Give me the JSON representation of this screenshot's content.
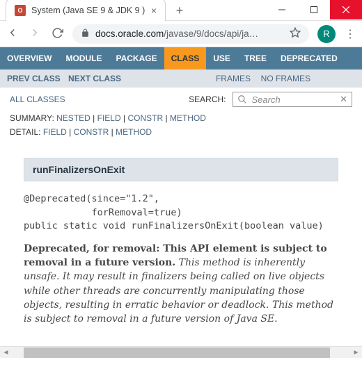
{
  "window": {
    "tab_title": "System (Java SE 9 & JDK 9 )",
    "favicon_letter": "O",
    "avatar_letter": "R"
  },
  "address": {
    "lock": "🔒",
    "domain": "docs.oracle.com",
    "path": "/javase/9/docs/api/ja…"
  },
  "nav": {
    "items": [
      "OVERVIEW",
      "MODULE",
      "PACKAGE",
      "CLASS",
      "USE",
      "TREE",
      "DEPRECATED"
    ],
    "active_index": 3,
    "sub": {
      "prev": "PREV CLASS",
      "next": "NEXT CLASS",
      "frames": "FRAMES",
      "noframes": "NO FRAMES"
    },
    "allclasses": "ALL CLASSES",
    "search_label": "SEARCH:",
    "search_placeholder": "Search",
    "summary_label": "SUMMARY:",
    "summary_links": [
      "NESTED",
      "FIELD",
      "CONSTR",
      "METHOD"
    ],
    "detail_label": "DETAIL:",
    "detail_links": [
      "FIELD",
      "CONSTR",
      "METHOD"
    ]
  },
  "method": {
    "name": "runFinalizersOnExit",
    "code": "@Deprecated(since=\"1.2\",\n            forRemoval=true)\npublic static void runFinalizersOnExit(boolean value)",
    "desc_bold_lead": "Deprecated, for removal: This API element is subject to removal in a future version.",
    "desc_rest": " This method is inherently unsafe. It may result in finalizers being called on live objects while other threads are concurrently manipulating those objects, resulting in erratic behavior or deadlock. This method is subject to removal in a future version of Java SE."
  }
}
